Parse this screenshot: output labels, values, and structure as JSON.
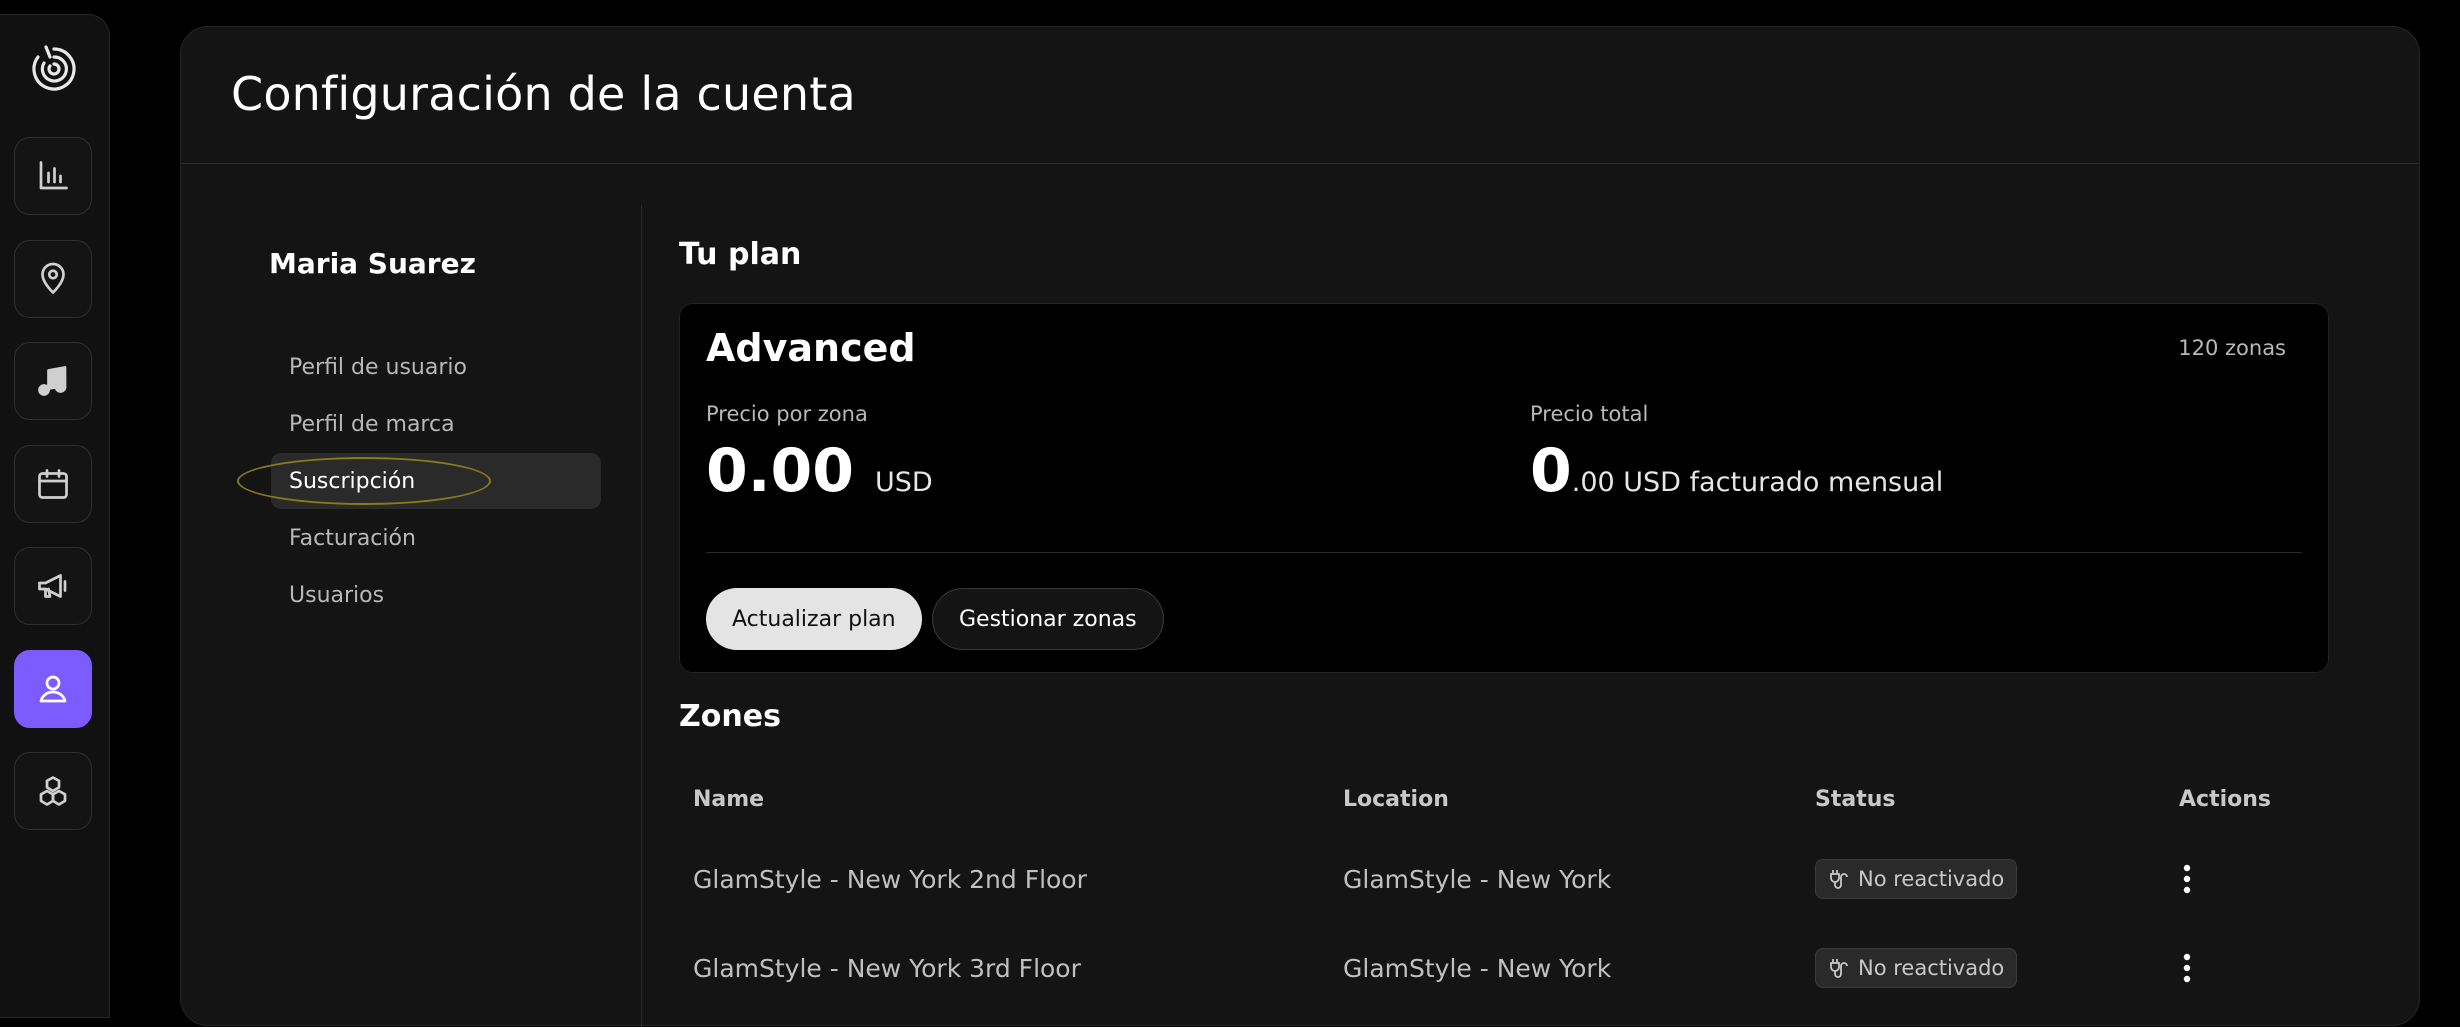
{
  "page": {
    "title": "Configuración de la cuenta"
  },
  "rail": {
    "items": [
      {
        "icon": "bar-chart-icon"
      },
      {
        "icon": "location-pin-icon"
      },
      {
        "icon": "music-note-icon"
      },
      {
        "icon": "calendar-icon"
      },
      {
        "icon": "megaphone-icon"
      },
      {
        "icon": "user-icon",
        "active": true
      },
      {
        "icon": "cubes-icon"
      }
    ],
    "accent": "#7c5cff"
  },
  "settings_nav": {
    "user_name": "Maria Suarez",
    "items": [
      {
        "label": "Perfil de usuario"
      },
      {
        "label": "Perfil de marca"
      },
      {
        "label": "Suscripción",
        "active": true
      },
      {
        "label": "Facturación"
      },
      {
        "label": "Usuarios"
      }
    ]
  },
  "plan": {
    "section_title": "Tu plan",
    "name": "Advanced",
    "zones_count": "120 zonas",
    "price_per_zone_label": "Precio por zona",
    "price_per_zone_value": "0.00",
    "price_per_zone_unit": "USD",
    "total_label": "Precio total",
    "total_value_whole": "0",
    "total_value_rest": ".00 USD facturado mensual",
    "update_button": "Actualizar plan",
    "manage_button": "Gestionar zonas"
  },
  "zones": {
    "section_title": "Zones",
    "columns": [
      "Name",
      "Location",
      "Status",
      "Actions"
    ],
    "rows": [
      {
        "name": "GlamStyle - New York 2nd Floor",
        "location": "GlamStyle - New York",
        "status": "No reactivado"
      },
      {
        "name": "GlamStyle - New York 3rd Floor",
        "location": "GlamStyle - New York",
        "status": "No reactivado"
      }
    ]
  }
}
